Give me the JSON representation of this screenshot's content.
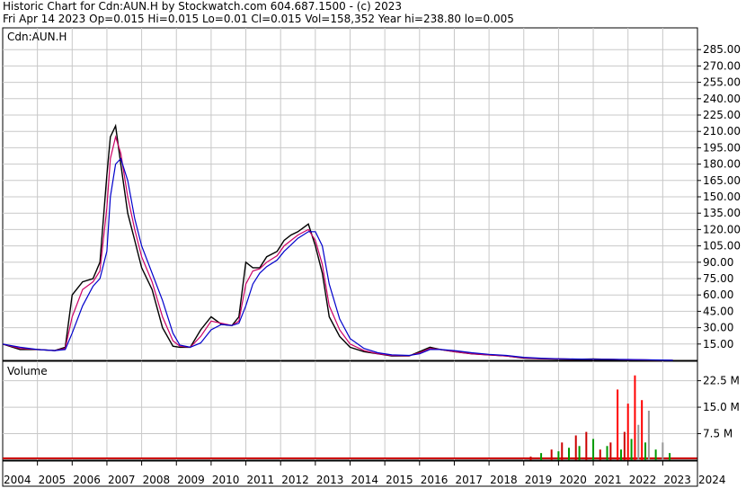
{
  "header": {
    "line1": "Historic Chart for Cdn:AUN.H by Stockwatch.com 604.687.1500 - (c) 2023",
    "line2": "Fri Apr 14 2023   Op=0.015   Hi=0.015   Lo=0.01   Cl=0.015   Vol=158,352   Year hi=238.80   lo=0.005"
  },
  "chart_data": {
    "type": "line",
    "price_panel_label": "Cdn:AUN.H",
    "volume_panel_label": "Volume",
    "x_tick_labels": [
      "2004",
      "2005",
      "2006",
      "2007",
      "2008",
      "2009",
      "2010",
      "2011",
      "2012",
      "2013",
      "2014",
      "2015",
      "2016",
      "2017",
      "2018",
      "2019",
      "2020",
      "2021",
      "2022",
      "2023",
      "2024"
    ],
    "price_ylim": [
      0,
      300
    ],
    "price_ticks": [
      "285.00",
      "270.00",
      "255.00",
      "240.00",
      "225.00",
      "210.00",
      "195.00",
      "180.00",
      "165.00",
      "150.00",
      "135.00",
      "120.00",
      "105.00",
      "90.00",
      "75.00",
      "60.00",
      "45.00",
      "30.00",
      "15.00"
    ],
    "volume_ylim": [
      0,
      28000000
    ],
    "volume_ticks": [
      "22.5 M",
      "15.0 M",
      "7.5 M"
    ],
    "price_series": {
      "x": [
        2004.0,
        2004.5,
        2005.0,
        2005.5,
        2005.8,
        2006.0,
        2006.3,
        2006.6,
        2006.8,
        2007.0,
        2007.1,
        2007.25,
        2007.4,
        2007.6,
        2007.8,
        2008.0,
        2008.3,
        2008.6,
        2008.9,
        2009.1,
        2009.4,
        2009.7,
        2010.0,
        2010.3,
        2010.6,
        2010.8,
        2011.0,
        2011.2,
        2011.4,
        2011.6,
        2011.9,
        2012.1,
        2012.3,
        2012.5,
        2012.8,
        2013.0,
        2013.2,
        2013.4,
        2013.7,
        2014.0,
        2014.4,
        2014.8,
        2015.2,
        2015.7,
        2016.0,
        2016.3,
        2016.6,
        2017.0,
        2017.5,
        2018.0,
        2018.5,
        2019.0,
        2019.5,
        2020.0,
        2020.5,
        2021.0,
        2021.5,
        2022.0,
        2022.5,
        2023.0,
        2023.29
      ],
      "close": [
        15,
        10,
        10,
        9,
        12,
        60,
        72,
        75,
        90,
        170,
        205,
        215,
        180,
        135,
        110,
        85,
        65,
        30,
        13,
        12,
        12,
        28,
        40,
        33,
        32,
        40,
        90,
        85,
        85,
        95,
        100,
        110,
        115,
        118,
        125,
        105,
        80,
        40,
        22,
        12,
        8,
        6,
        4,
        4,
        8,
        12,
        10,
        8,
        6,
        5,
        4,
        2,
        1.5,
        1.2,
        1.0,
        1.2,
        0.8,
        0.5,
        0.3,
        0.1,
        0.015
      ],
      "ma_short": [
        15,
        11,
        10,
        9,
        11,
        40,
        65,
        72,
        82,
        140,
        185,
        205,
        190,
        150,
        120,
        95,
        72,
        40,
        18,
        13,
        12,
        22,
        36,
        34,
        32,
        36,
        70,
        82,
        84,
        90,
        96,
        105,
        110,
        115,
        120,
        110,
        88,
        50,
        28,
        15,
        9,
        6,
        4.5,
        4.2,
        7,
        11,
        10,
        8,
        6,
        5,
        4,
        2.2,
        1.6,
        1.3,
        1.1,
        1.1,
        0.9,
        0.6,
        0.4,
        0.2,
        0.05
      ],
      "ma_long": [
        15,
        12,
        10,
        9,
        10,
        25,
        50,
        68,
        75,
        100,
        150,
        180,
        185,
        165,
        130,
        105,
        80,
        55,
        25,
        14,
        12,
        16,
        28,
        33,
        32,
        34,
        50,
        70,
        80,
        86,
        92,
        100,
        106,
        112,
        118,
        118,
        105,
        70,
        38,
        20,
        11,
        7,
        5,
        4.5,
        6,
        10,
        10,
        9,
        7,
        5.5,
        4.5,
        2.8,
        2.0,
        1.5,
        1.2,
        1.1,
        1.0,
        0.8,
        0.6,
        0.3,
        0.1
      ]
    },
    "volume_series": {
      "x": [
        2019.2,
        2019.5,
        2019.8,
        2020.0,
        2020.1,
        2020.3,
        2020.5,
        2020.6,
        2020.8,
        2021.0,
        2021.2,
        2021.4,
        2021.5,
        2021.7,
        2021.8,
        2021.9,
        2022.0,
        2022.1,
        2022.2,
        2022.3,
        2022.4,
        2022.5,
        2022.6,
        2022.8,
        2023.0,
        2023.2
      ],
      "values": [
        1000000,
        2000000,
        3000000,
        2500000,
        5000000,
        3500000,
        7000000,
        4000000,
        8000000,
        6000000,
        3000000,
        4000000,
        5000000,
        20000000,
        3000000,
        8000000,
        16000000,
        6000000,
        24000000,
        10000000,
        17000000,
        5000000,
        14000000,
        3000000,
        5000000,
        2000000
      ],
      "colors": [
        "#cc0000",
        "#009900",
        "#cc0000",
        "#009900",
        "#cc0000",
        "#009900",
        "#cc0000",
        "#009900",
        "#cc0000",
        "#009900",
        "#cc0000",
        "#009900",
        "#cc0000",
        "#ff0000",
        "#009900",
        "#cc0000",
        "#ff0000",
        "#009900",
        "#ff0000",
        "#999999",
        "#ff0000",
        "#009900",
        "#999999",
        "#009900",
        "#999999",
        "#009900"
      ]
    },
    "grid": true,
    "colors": {
      "price": "#000000",
      "ma_short": "#cc0066",
      "ma_long": "#0000cc"
    }
  }
}
